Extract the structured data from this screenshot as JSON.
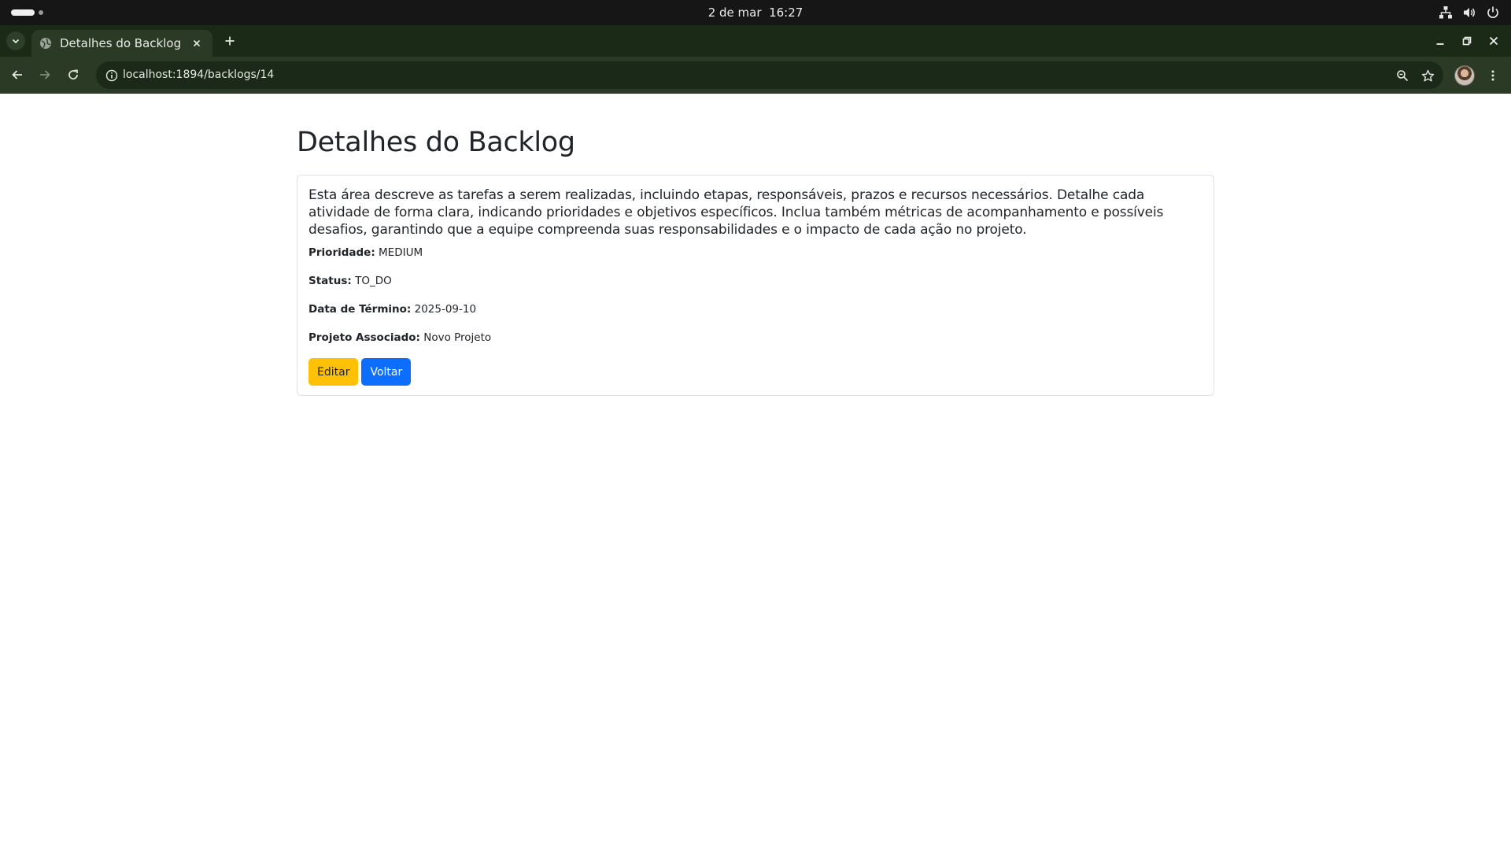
{
  "system_bar": {
    "date": "2 de mar",
    "time": "16:27"
  },
  "browser": {
    "tab_title": "Detalhes do Backlog",
    "url": "localhost:1894/backlogs/14"
  },
  "page": {
    "title": "Detalhes do Backlog",
    "description": "Esta área descreve as tarefas a serem realizadas, incluindo etapas, responsáveis, prazos e recursos necessários. Detalhe cada atividade de forma clara, indicando prioridades e objetivos específicos. Inclua também métricas de acompanhamento e possíveis desafios, garantindo que a equipe compreenda suas responsabilidades e o impacto de cada ação no projeto.",
    "fields": {
      "priority_label": "Prioridade:",
      "priority_value": "MEDIUM",
      "status_label": "Status:",
      "status_value": "TO_DO",
      "due_label": "Data de Término:",
      "due_value": "2025-09-10",
      "project_label": "Projeto Associado:",
      "project_value": "Novo Projeto"
    },
    "buttons": {
      "edit": "Editar",
      "back": "Voltar"
    }
  },
  "colors": {
    "edit_button": "#ffc107",
    "back_button": "#0d6efd",
    "browser_chrome": "#2a3a25"
  }
}
